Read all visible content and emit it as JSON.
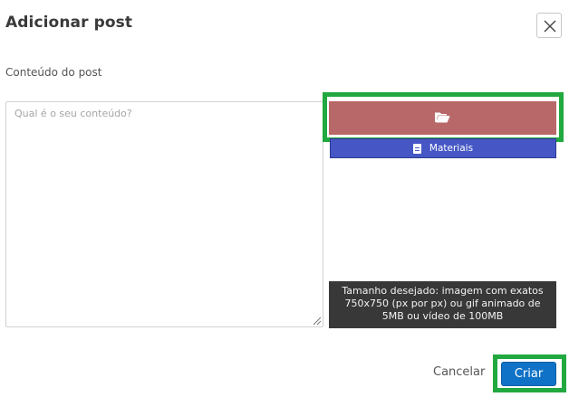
{
  "dialog": {
    "title": "Adicionar post",
    "close_icon": "close-icon"
  },
  "content_field": {
    "label": "Conteúdo do post",
    "value": "",
    "placeholder": "Qual é o seu conteúdo?"
  },
  "media": {
    "upload_icon": "folder-open-icon",
    "upload_color": "#b86868",
    "materials_label": "Materiais",
    "materials_icon": "document-icon",
    "materials_color": "#4657c5",
    "hint": "Tamanho desejado: imagem com exatos 750x750 (px por px) ou gif animado de 5MB ou vídeo de 100MB"
  },
  "footer": {
    "cancel_label": "Cancelar",
    "create_label": "Criar",
    "create_color": "#1072c6"
  },
  "highlight_color": "#21a83f"
}
